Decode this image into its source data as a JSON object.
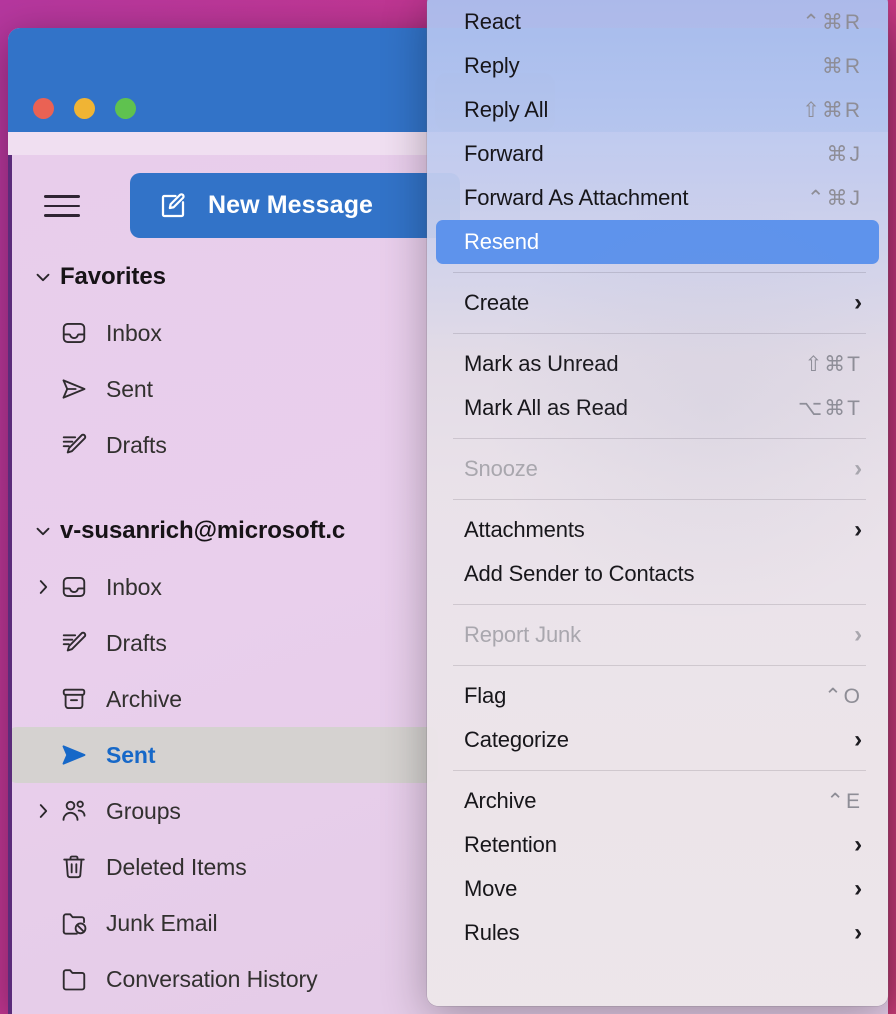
{
  "desktop": {
    "wallpaper_color": "#c3368f"
  },
  "window": {
    "traffic_lights": [
      {
        "name": "close",
        "color": "#ea6254"
      },
      {
        "name": "minimize",
        "color": "#f0b434"
      },
      {
        "name": "maximize",
        "color": "#5fc24f"
      }
    ],
    "titlebar_color": "#3273c8"
  },
  "sidebar": {
    "new_message_label": "New Message",
    "accent_color": "#3273c8",
    "selected_color": "#1668c8",
    "sections": [
      {
        "title": "Favorites",
        "expanded": true,
        "items": [
          {
            "label": "Inbox",
            "icon": "inbox-icon",
            "twisty": "",
            "selected": false
          },
          {
            "label": "Sent",
            "icon": "sent-icon",
            "twisty": "",
            "selected": false
          },
          {
            "label": "Drafts",
            "icon": "drafts-icon",
            "twisty": "",
            "selected": false
          }
        ]
      },
      {
        "title": "v-susanrich@microsoft.c",
        "expanded": true,
        "items": [
          {
            "label": "Inbox",
            "icon": "inbox-icon",
            "twisty": "collapsed",
            "selected": false
          },
          {
            "label": "Drafts",
            "icon": "drafts-icon",
            "twisty": "",
            "selected": false
          },
          {
            "label": "Archive",
            "icon": "archive-icon",
            "twisty": "",
            "selected": false
          },
          {
            "label": "Sent",
            "icon": "sent-icon",
            "twisty": "",
            "selected": true
          },
          {
            "label": "Groups",
            "icon": "groups-icon",
            "twisty": "collapsed",
            "selected": false
          },
          {
            "label": "Deleted Items",
            "icon": "trash-icon",
            "twisty": "",
            "selected": false
          },
          {
            "label": "Junk Email",
            "icon": "junk-icon",
            "twisty": "",
            "selected": false
          },
          {
            "label": "Conversation History",
            "icon": "folder-icon",
            "twisty": "",
            "selected": false
          }
        ]
      }
    ]
  },
  "context_menu": {
    "highlight_color": "#5e93ec",
    "items": [
      {
        "type": "item",
        "label": "React",
        "shortcut": "⌃⌘R",
        "arrow": false,
        "disabled": false,
        "highlighted": false
      },
      {
        "type": "item",
        "label": "Reply",
        "shortcut": "⌘R",
        "arrow": false,
        "disabled": false,
        "highlighted": false
      },
      {
        "type": "item",
        "label": "Reply All",
        "shortcut": "⇧⌘R",
        "arrow": false,
        "disabled": false,
        "highlighted": false
      },
      {
        "type": "item",
        "label": "Forward",
        "shortcut": "⌘J",
        "arrow": false,
        "disabled": false,
        "highlighted": false
      },
      {
        "type": "item",
        "label": "Forward As Attachment",
        "shortcut": "⌃⌘J",
        "arrow": false,
        "disabled": false,
        "highlighted": false
      },
      {
        "type": "item",
        "label": "Resend",
        "shortcut": "",
        "arrow": false,
        "disabled": false,
        "highlighted": true
      },
      {
        "type": "separator"
      },
      {
        "type": "item",
        "label": "Create",
        "shortcut": "",
        "arrow": true,
        "disabled": false,
        "highlighted": false
      },
      {
        "type": "separator"
      },
      {
        "type": "item",
        "label": "Mark as Unread",
        "shortcut": "⇧⌘T",
        "arrow": false,
        "disabled": false,
        "highlighted": false
      },
      {
        "type": "item",
        "label": "Mark All as Read",
        "shortcut": "⌥⌘T",
        "arrow": false,
        "disabled": false,
        "highlighted": false
      },
      {
        "type": "separator"
      },
      {
        "type": "item",
        "label": "Snooze",
        "shortcut": "",
        "arrow": true,
        "disabled": true,
        "highlighted": false
      },
      {
        "type": "separator"
      },
      {
        "type": "item",
        "label": "Attachments",
        "shortcut": "",
        "arrow": true,
        "disabled": false,
        "highlighted": false
      },
      {
        "type": "item",
        "label": "Add Sender to Contacts",
        "shortcut": "",
        "arrow": false,
        "disabled": false,
        "highlighted": false
      },
      {
        "type": "separator"
      },
      {
        "type": "item",
        "label": "Report Junk",
        "shortcut": "",
        "arrow": true,
        "disabled": true,
        "highlighted": false
      },
      {
        "type": "separator"
      },
      {
        "type": "item",
        "label": "Flag",
        "shortcut": "⌃O",
        "arrow": false,
        "disabled": false,
        "highlighted": false
      },
      {
        "type": "item",
        "label": "Categorize",
        "shortcut": "",
        "arrow": true,
        "disabled": false,
        "highlighted": false
      },
      {
        "type": "separator"
      },
      {
        "type": "item",
        "label": "Archive",
        "shortcut": "⌃E",
        "arrow": false,
        "disabled": false,
        "highlighted": false
      },
      {
        "type": "item",
        "label": "Retention",
        "shortcut": "",
        "arrow": true,
        "disabled": false,
        "highlighted": false
      },
      {
        "type": "item",
        "label": "Move",
        "shortcut": "",
        "arrow": true,
        "disabled": false,
        "highlighted": false
      },
      {
        "type": "item",
        "label": "Rules",
        "shortcut": "",
        "arrow": true,
        "disabled": false,
        "highlighted": false
      }
    ]
  }
}
